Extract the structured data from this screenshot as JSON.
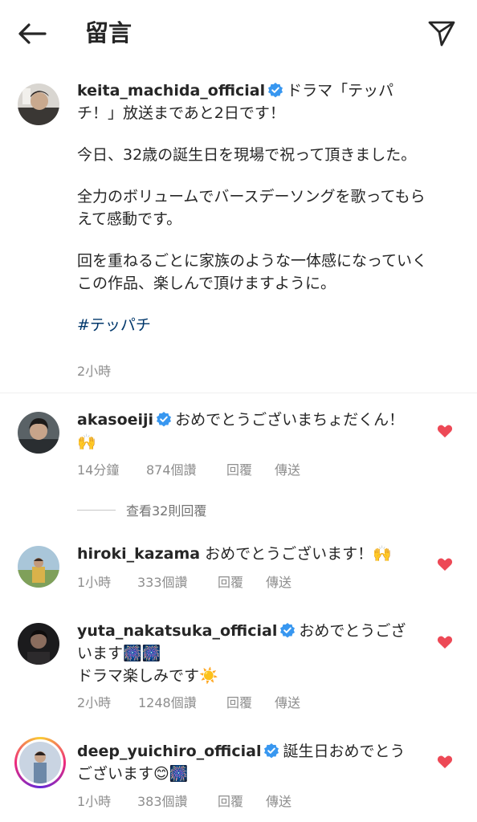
{
  "header": {
    "title": "留言",
    "back_icon": "arrow-left-icon",
    "send_icon": "paper-plane-icon"
  },
  "post": {
    "username": "keita_machida_official",
    "verified": true,
    "caption_line1": "ドラマ「テッパ",
    "caption_line2": "チ！」放送まであと2日です！",
    "para1": "今日、32歳の誕生日を現場で祝って頂きました。",
    "para2": "全力のボリュームでバースデーソングを歌ってもらえて感動です。",
    "para3": "回を重ねるごとに家族のような一体感になっていくこの作品、楽しんで頂けますように。",
    "hashtag": "#テッパチ",
    "time": "2小時"
  },
  "comments": [
    {
      "username": "akasoeiji",
      "verified": true,
      "text": "おめでとうございまちょだくん！🙌",
      "time": "14分鐘",
      "likes": "874個讚",
      "reply": "回覆",
      "share": "傳送",
      "liked": true
    },
    {
      "username": "hiroki_kazama",
      "verified": false,
      "text": "おめでとうございます！🙌",
      "time": "1小時",
      "likes": "333個讚",
      "reply": "回覆",
      "share": "傳送",
      "liked": true
    },
    {
      "username": "yuta_nakatsuka_official",
      "verified": true,
      "text_line1": "おめでとうござ",
      "text_line2": "います🎆🎆",
      "text_line3": "ドラマ楽しみです☀️",
      "time": "2小時",
      "likes": "1248個讚",
      "reply": "回覆",
      "share": "傳送",
      "liked": true
    },
    {
      "username": "deep_yuichiro_official",
      "verified": true,
      "text_line1": "誕生日おめでとう",
      "text_line2": "ございます😊🎆",
      "time": "1小時",
      "likes": "383個讚",
      "reply": "回覆",
      "share": "傳送",
      "liked": true
    }
  ],
  "view_replies": "查看32則回覆",
  "colors": {
    "heart": "#ed4956",
    "verified": "#3897f0",
    "hashtag": "#00376b",
    "meta": "#8e8e8e"
  }
}
